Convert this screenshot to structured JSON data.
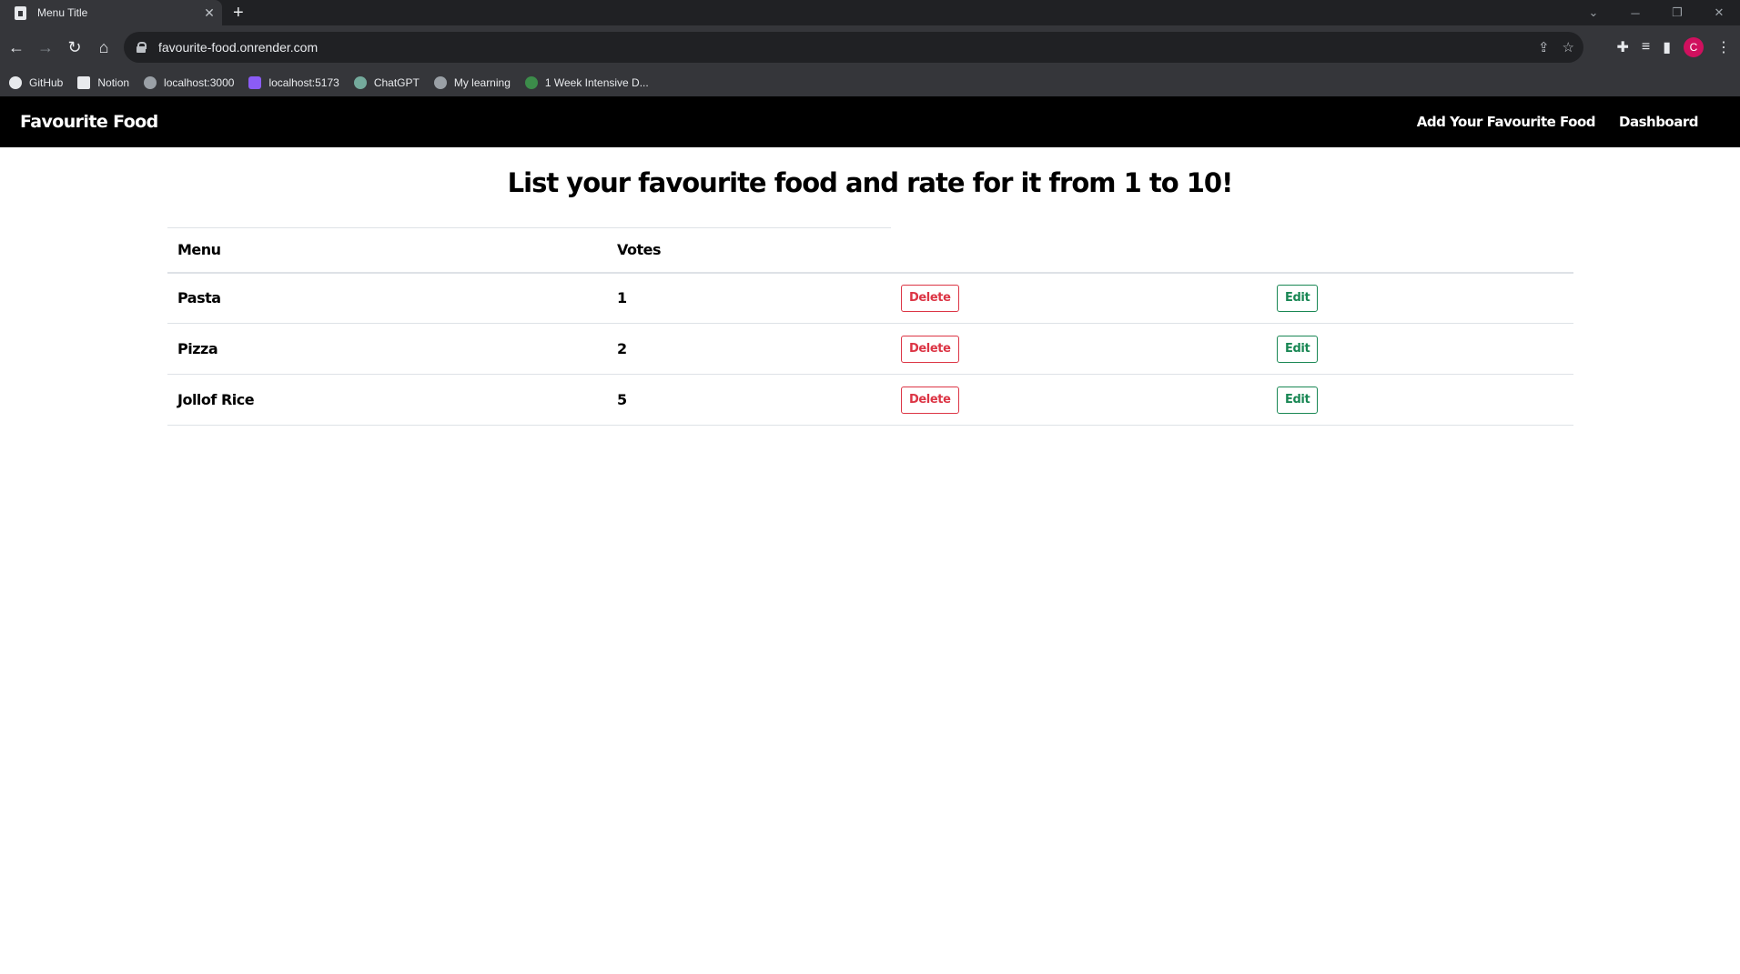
{
  "browser": {
    "tab_title": "Menu Title",
    "tab_close": "✕",
    "new_tab": "+",
    "url": "favourite-food.onrender.com",
    "profile_initial": "C",
    "bookmarks": [
      {
        "label": "GitHub",
        "icon": "github-icon"
      },
      {
        "label": "Notion",
        "icon": "notion-icon"
      },
      {
        "label": "localhost:3000",
        "icon": "globe-icon"
      },
      {
        "label": "localhost:5173",
        "icon": "app-icon"
      },
      {
        "label": "ChatGPT",
        "icon": "chatgpt-icon"
      },
      {
        "label": "My learning",
        "icon": "learning-icon"
      },
      {
        "label": "1 Week Intensive D...",
        "icon": "course-icon"
      }
    ]
  },
  "nav": {
    "brand": "Favourite Food",
    "links": [
      "Add Your Favourite Food",
      "Dashboard"
    ]
  },
  "main": {
    "title": "List your favourite food and rate for it from 1 to 10!",
    "table": {
      "headers": [
        "Menu",
        "Votes"
      ],
      "rows": [
        {
          "menu": "Pasta",
          "votes": "1",
          "delete_label": "Delete",
          "edit_label": "Edit"
        },
        {
          "menu": "Pizza",
          "votes": "2",
          "delete_label": "Delete",
          "edit_label": "Edit"
        },
        {
          "menu": "Jollof Rice",
          "votes": "5",
          "delete_label": "Delete",
          "edit_label": "Edit"
        }
      ]
    }
  },
  "colors": {
    "navbar": "#000000",
    "delete": "#dc3545",
    "edit": "#198754"
  }
}
